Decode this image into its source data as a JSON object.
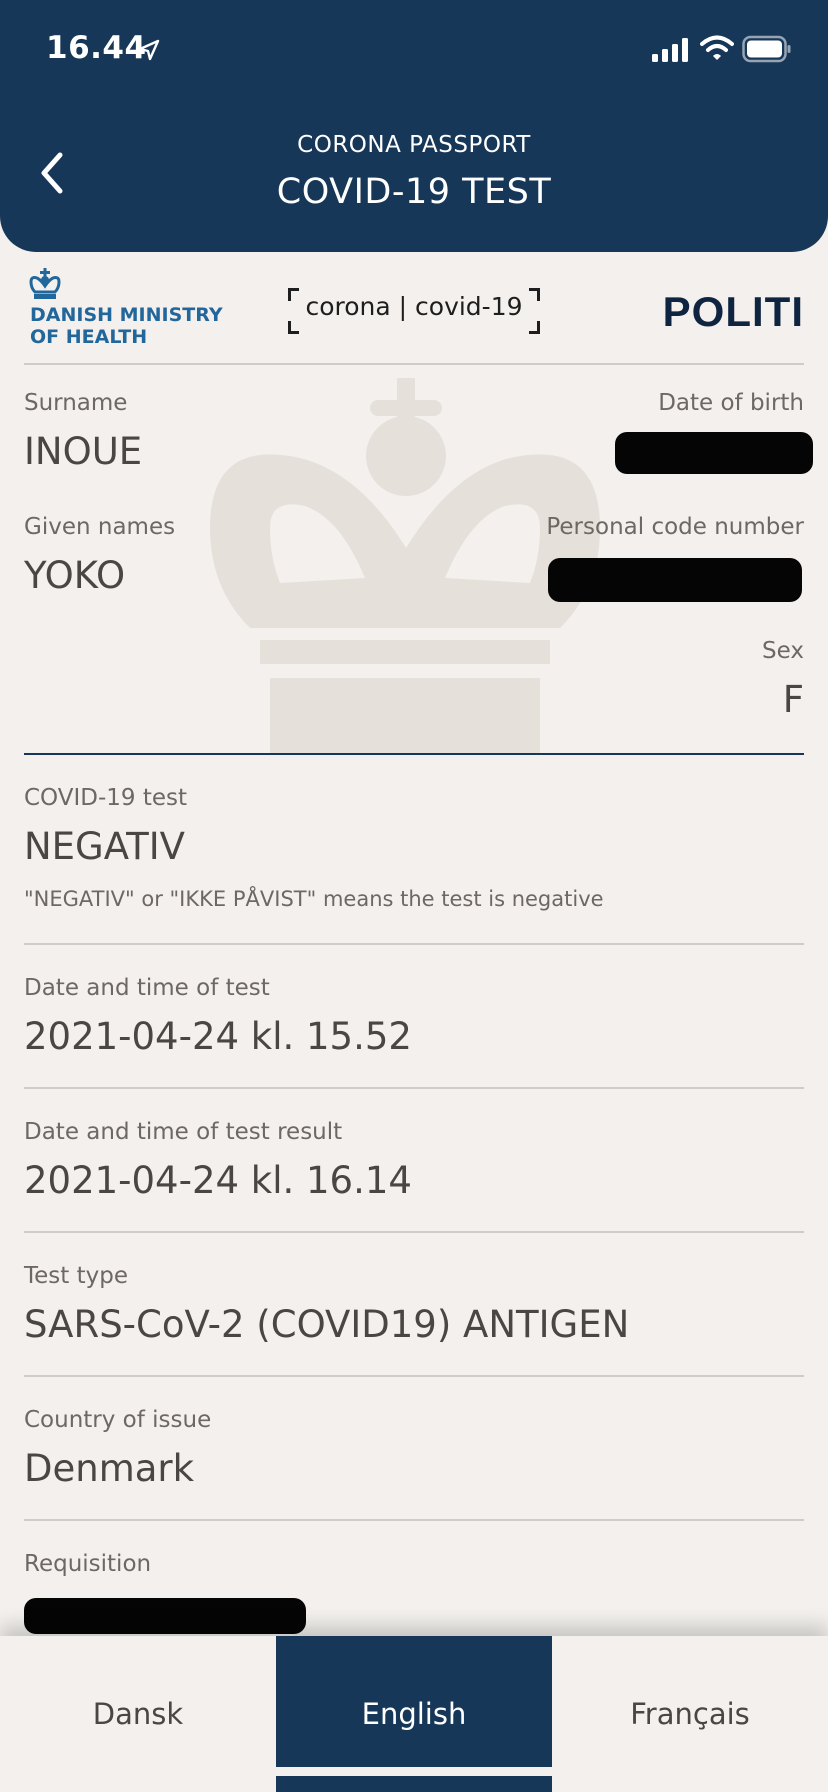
{
  "status_bar": {
    "time": "16.44"
  },
  "header": {
    "subtitle": "CORONA PASSPORT",
    "title": "COVID-19 TEST"
  },
  "logos": {
    "ministry_line1": "DANISH MINISTRY",
    "ministry_line2": "OF HEALTH",
    "corona": "corona | covid-19",
    "politi": "POLITI"
  },
  "person": {
    "surname_label": "Surname",
    "surname": "INOUE",
    "dob_label": "Date of birth",
    "given_names_label": "Given names",
    "given_names": "YOKO",
    "personal_code_label": "Personal code number",
    "sex_label": "Sex",
    "sex": "F"
  },
  "test": {
    "covid_label": "COVID-19 test",
    "covid_result": "NEGATIV",
    "covid_note": "\"NEGATIV\" or \"IKKE PÅVIST\" means the test is negative",
    "datetime_label": "Date and time of test",
    "datetime": "2021-04-24 kl. 15.52",
    "result_datetime_label": "Date and time of test result",
    "result_datetime": "2021-04-24 kl. 16.14",
    "type_label": "Test type",
    "type": "SARS-CoV-2 (COVID19) ANTIGEN",
    "country_label": "Country of issue",
    "country": "Denmark",
    "requisition_label": "Requisition"
  },
  "tabs": [
    {
      "label": "Dansk",
      "active": false
    },
    {
      "label": "English",
      "active": true
    },
    {
      "label": "Français",
      "active": false
    }
  ],
  "colors": {
    "primary": "#173758",
    "background": "#f3f0ed",
    "ministry_blue": "#22679b"
  },
  "icons": {
    "back": "chevron-left-icon",
    "location": "location-arrow-icon",
    "signal": "cellular-signal-icon",
    "wifi": "wifi-icon",
    "battery": "battery-icon"
  }
}
